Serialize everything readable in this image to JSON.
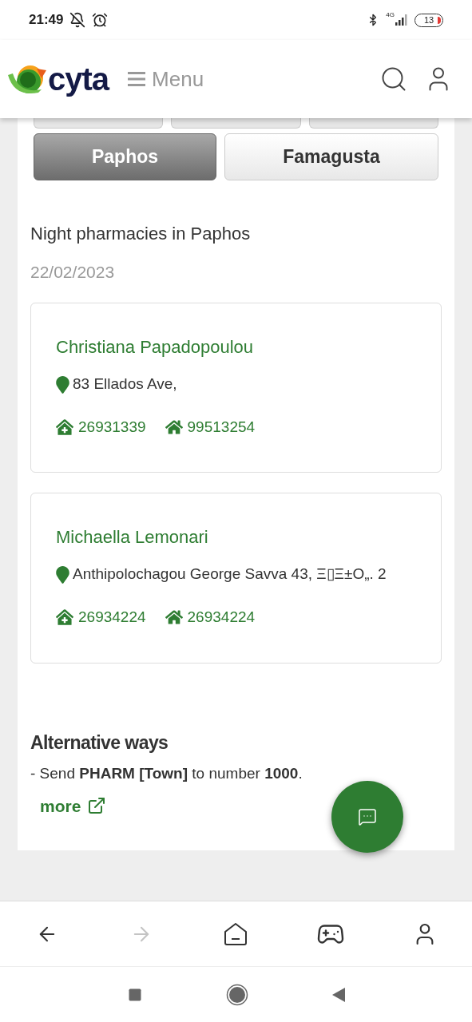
{
  "status_bar": {
    "time": "21:49",
    "battery": "13",
    "network": "4G"
  },
  "header": {
    "logo_text": "cyta",
    "menu_label": "Menu"
  },
  "tabs": [
    {
      "kind": "cut",
      "selected": false
    },
    {
      "kind": "cut",
      "selected": false
    },
    {
      "kind": "cut",
      "selected": false
    },
    {
      "kind": "full",
      "label": "Paphos",
      "selected": true
    },
    {
      "kind": "full",
      "label": "Famagusta",
      "selected": false
    }
  ],
  "title": "Night pharmacies in Paphos",
  "date": "22/02/2023",
  "pharmacies": [
    {
      "name": "Christiana Papadopoulou",
      "address": "83 Ellados Ave,",
      "phones": [
        {
          "kind": "clinic",
          "number": "26931339"
        },
        {
          "kind": "home",
          "number": "99513254"
        }
      ]
    },
    {
      "name": "Michaella Lemonari",
      "address": "Anthipolochagou George Savva 43, Ξ▯Ξ±Ο„. 2",
      "phones": [
        {
          "kind": "clinic",
          "number": "26934224"
        },
        {
          "kind": "home",
          "number": "26934224"
        }
      ]
    }
  ],
  "alternative": {
    "heading": "Alternative ways",
    "text": "- Send **PHARM [Town]** to number **1000**.",
    "link": "more"
  },
  "browser_bar": [
    {
      "kind": "back",
      "disabled": false
    },
    {
      "kind": "forward",
      "disabled": true
    },
    {
      "kind": "home",
      "disabled": false
    },
    {
      "kind": "games",
      "disabled": false
    },
    {
      "kind": "profile",
      "disabled": false
    }
  ]
}
